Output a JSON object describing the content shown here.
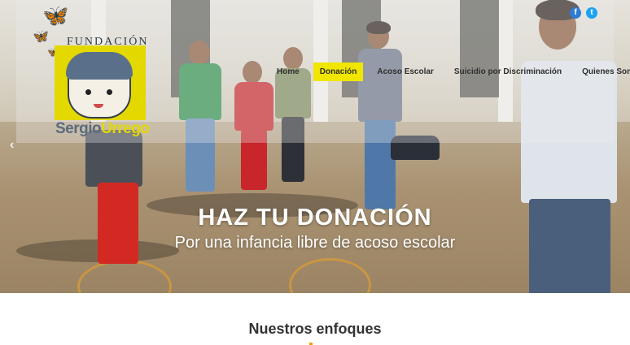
{
  "brand": {
    "top_text": "FUNDACIÓN",
    "name_part1": "Sergio",
    "name_part2": "Urrego",
    "colors": {
      "yellow": "#f0e600",
      "blue": "#2e7bd3"
    }
  },
  "nav": {
    "items": [
      {
        "label": "Home",
        "active": false
      },
      {
        "label": "Donación",
        "active": true
      },
      {
        "label": "Acoso Escolar",
        "active": false
      },
      {
        "label": "Suicidio por Discriminación",
        "active": false
      },
      {
        "label": "Quienes Somos",
        "active": false
      }
    ]
  },
  "social": {
    "facebook": {
      "icon": "facebook-icon",
      "glyph": "f"
    },
    "twitter": {
      "icon": "twitter-icon",
      "glyph": "t"
    }
  },
  "hero": {
    "title": "HAZ TU DONACIÓN",
    "subtitle": "Por una infancia libre de acoso escolar",
    "prev_arrow": "‹"
  },
  "section": {
    "title": "Nuestros enfoques"
  }
}
